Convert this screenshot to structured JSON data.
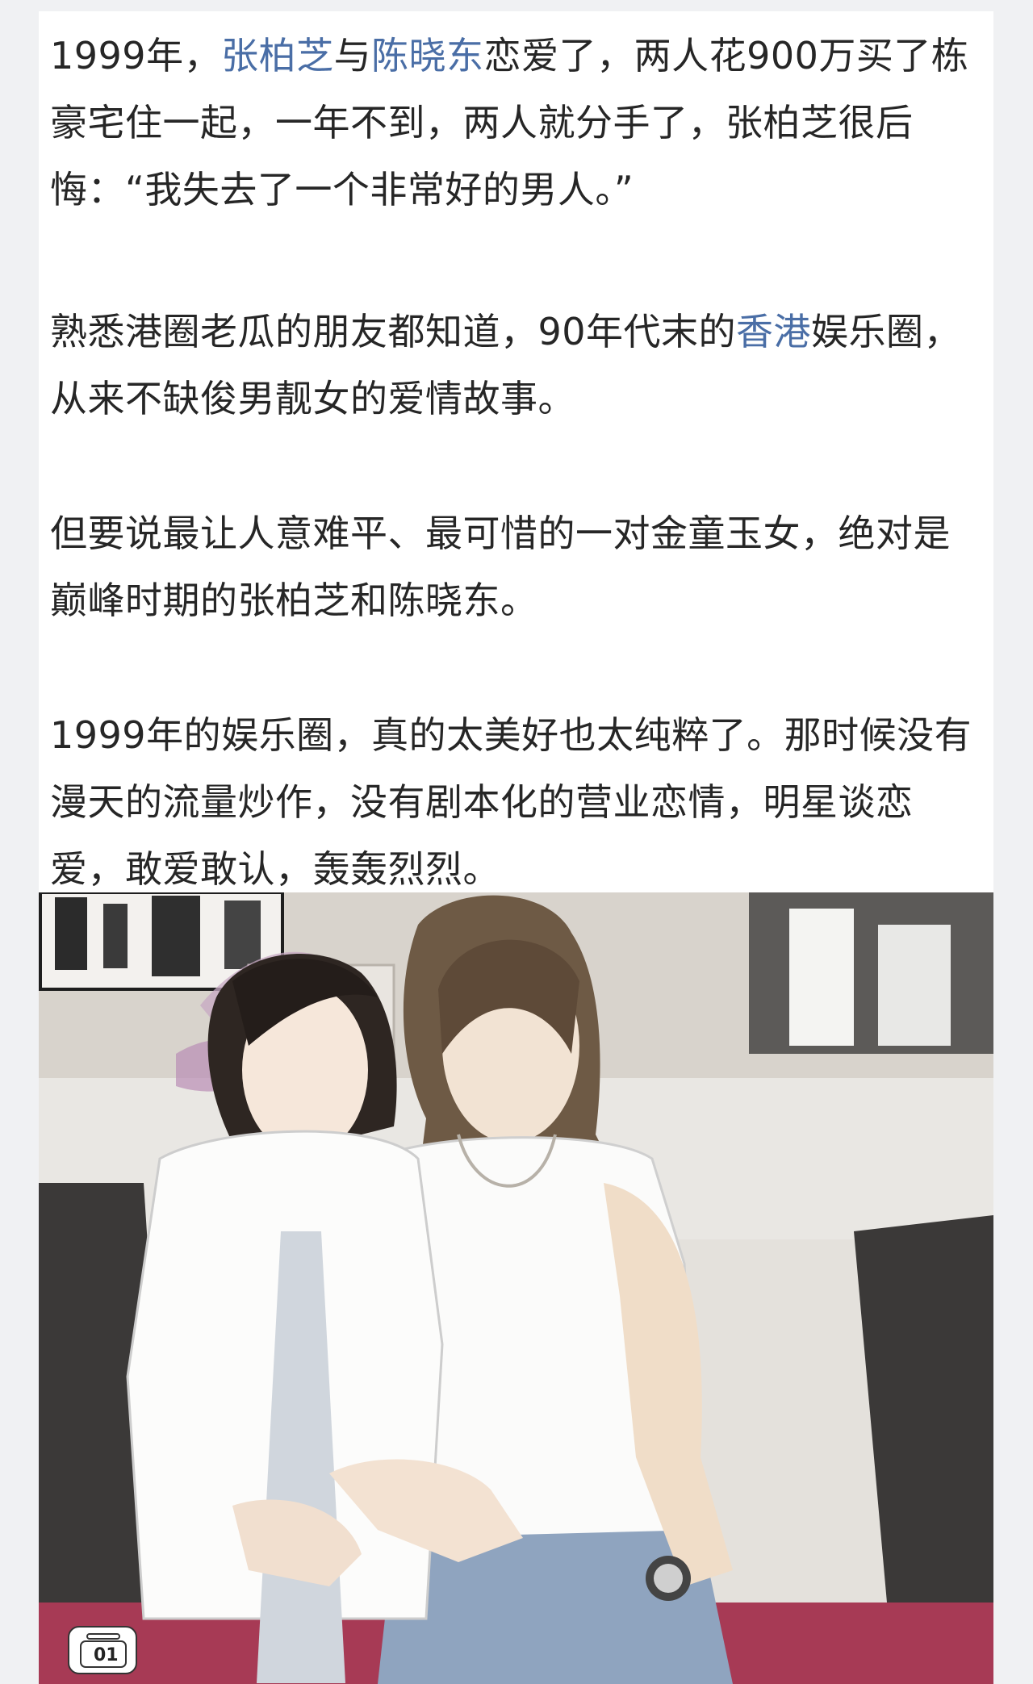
{
  "article": {
    "paragraphs": [
      {
        "segments": [
          {
            "text": "1999年，",
            "link": false
          },
          {
            "text": "张柏芝",
            "link": true
          },
          {
            "text": "与",
            "link": false
          },
          {
            "text": "陈晓东",
            "link": true
          },
          {
            "text": "恋爱了，两人花900万买了栋豪宅住一起，一年不到，两人就分手了，张柏芝很后悔：“我失去了一个非常好的男人。”",
            "link": false
          }
        ]
      },
      {
        "segments": [
          {
            "text": "熟悉港圈老瓜的朋友都知道，90年代末的",
            "link": false
          },
          {
            "text": "香港",
            "link": true
          },
          {
            "text": "娱乐圈，从来不缺俊男靓女的爱情故事。",
            "link": false
          }
        ]
      },
      {
        "segments": [
          {
            "text": "但要说最让人意难平、最可惜的一对金童玉女，绝对是巅峰时期的张柏芝和陈晓东。",
            "link": false
          }
        ]
      },
      {
        "segments": [
          {
            "text": "1999年的娱乐圈，真的太美好也太纯粹了。那时候没有漫天的流量炒作，没有剧本化的营业恋情，明星谈恋爱，敢爱敢认，轰轰烈烈。",
            "link": false
          }
        ]
      }
    ],
    "link_color": "#4a6ea6",
    "text_color": "#262626"
  },
  "photo": {
    "counter_label": "01",
    "counter_icon": "image-stack-icon"
  }
}
